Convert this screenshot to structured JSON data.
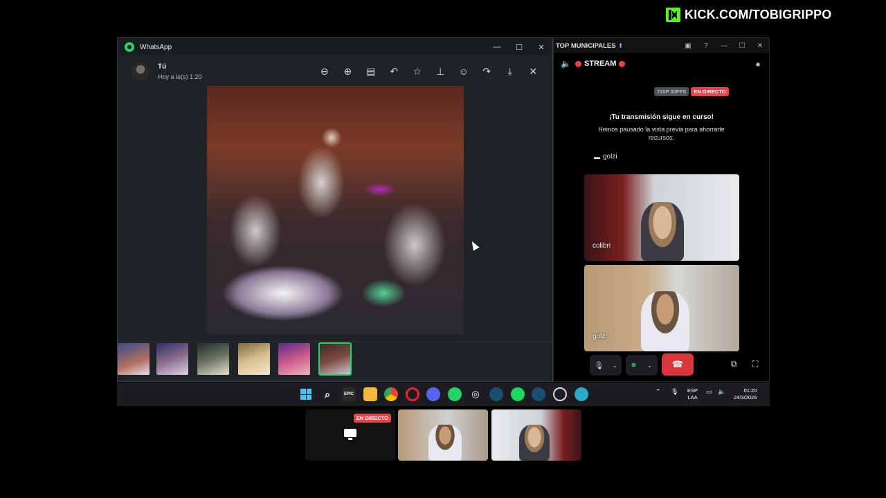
{
  "watermark": {
    "text": "KICK.COM/TOBIGRIPPO"
  },
  "whatsapp": {
    "title": "WhatsApp",
    "window_controls": [
      "—",
      "☐",
      "✕"
    ],
    "sender": "Tú",
    "time": "Hoy a la(s) 1:20",
    "toolbar": [
      "search-icon",
      "zoom-in-icon",
      "caption-icon",
      "reply-icon",
      "star-icon",
      "pin-icon",
      "emoji-icon",
      "forward-icon",
      "download-icon",
      "close-icon"
    ],
    "thumbnail_count": 6,
    "active_thumbnail": 6
  },
  "discord": {
    "title": "TOP MUNICIPALES",
    "window_controls": [
      "—",
      "☐",
      "✕"
    ],
    "stream_label": "STREAM",
    "quality_badge": "720P 30FPS",
    "live_badge": "EN DIRECTO",
    "notice_title": "¡Tu transmisión sigue en curso!",
    "notice_body": "Hemos pausado la vista previa para ahorrarte recursos.",
    "streamer": "golzi",
    "participants": [
      {
        "name": "colibri"
      },
      {
        "name": "golzi"
      }
    ]
  },
  "taskbar": {
    "lang_1": "ESP",
    "lang_2": "LAA",
    "time": "01:20",
    "date": "24/3/2026"
  },
  "preview": {
    "live_badge": "EN DIRECTO"
  },
  "colors": {
    "whatsapp_green": "#25d366",
    "discord_red": "#da373c",
    "kick_green": "#53fc18"
  }
}
